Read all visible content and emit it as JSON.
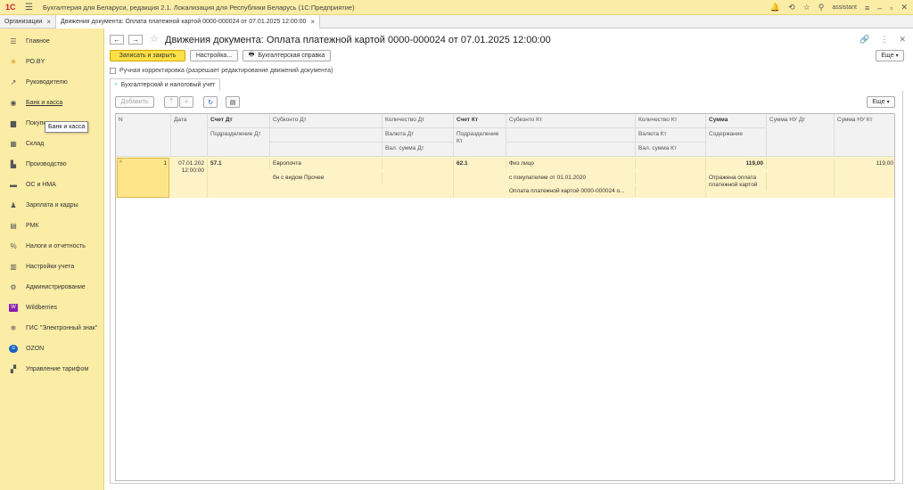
{
  "app": {
    "title": "Бухгалтерия для Беларуси, редакция 2.1. Локализация для Республики Беларусь",
    "platform": "(1С:Предприятие)",
    "user": "assistant"
  },
  "tabs": [
    {
      "label": "Организации"
    },
    {
      "label": "Движения документа: Оплата платежной картой 0000-000024 от 07.01.2025 12:00:00"
    }
  ],
  "sidebar": {
    "items": [
      {
        "label": "Главное",
        "icon": "menu-icon"
      },
      {
        "label": "РО.BY",
        "icon": "sun-icon"
      },
      {
        "label": "Руководителю",
        "icon": "trend-icon"
      },
      {
        "label": "Банк и касса",
        "icon": "bank-icon"
      },
      {
        "label": "Покупки",
        "icon": "cart-icon"
      },
      {
        "label": "Склад",
        "icon": "warehouse-icon"
      },
      {
        "label": "Производство",
        "icon": "factory-icon"
      },
      {
        "label": "ОС и НМА",
        "icon": "truck-icon"
      },
      {
        "label": "Зарплата и кадры",
        "icon": "people-icon"
      },
      {
        "label": "РМК",
        "icon": "cash-register-icon"
      },
      {
        "label": "Налоги и отчетность",
        "icon": "percent-icon"
      },
      {
        "label": "Настройки учета",
        "icon": "settings-doc-icon"
      },
      {
        "label": "Администрирование",
        "icon": "gear-icon"
      },
      {
        "label": "Wildberries",
        "icon": "wildberries-icon"
      },
      {
        "label": "ГИС \"Электронный знак\"",
        "icon": "snowflake-icon"
      },
      {
        "label": "OZON",
        "icon": "ozon-icon"
      },
      {
        "label": "Управление тарифом",
        "icon": "tariff-icon"
      }
    ],
    "tooltip": "Банк и касса"
  },
  "document": {
    "title": "Движения документа: Оплата платежной картой 0000-000024 от 07.01.2025 12:00:00",
    "buttons": {
      "save_close": "Записать и закрыть",
      "settings": "Настройка...",
      "reference": "Бухгалтерская справка",
      "more": "Еще"
    },
    "manual_checkbox": "Ручная корректировка (разрешает редактирование движений документа)",
    "subtab": "Бухгалтерский и налоговый учет",
    "table_toolbar": {
      "add": "Добавить",
      "more": "Еще"
    }
  },
  "table": {
    "headers": {
      "n": "N",
      "date": "Дата",
      "acc_dt": "Счет Дт",
      "dept_dt": "Подразделение Дт",
      "subconto_dt": "Субконто Дт",
      "qty_dt": "Количество Дт",
      "cur_dt": "Валюта Дт",
      "cursum_dt": "Вал. сумма Дт",
      "acc_kt": "Счет Кт",
      "dept_kt": "Подразделение Кт",
      "subconto_kt": "Субконто Кт",
      "qty_kt": "Количество Кт",
      "cur_kt": "Валюта Кт",
      "cursum_kt": "Вал. сумма Кт",
      "sum": "Сумма",
      "content": "Содержание",
      "sum_nu_dt": "Сумма НУ Дт",
      "sum_nu_kt": "Сумма НУ Кт"
    },
    "row": {
      "n": "1",
      "date": "07.01.202",
      "time": "12:00:00",
      "acc_dt": "57.1",
      "sub_dt_1": "Европочта",
      "sub_dt_2": "бн с видом Прочее",
      "acc_kt": "62.1",
      "sub_kt_1": "Физ лицо",
      "sub_kt_2": "с покупателем от 01.01.2020",
      "sub_kt_3": "Оплата платежной картой 0000-000024 о...",
      "sum": "119,00",
      "content": "Отражена оплата платежной картой",
      "sum_nu_kt": "119,00"
    }
  }
}
